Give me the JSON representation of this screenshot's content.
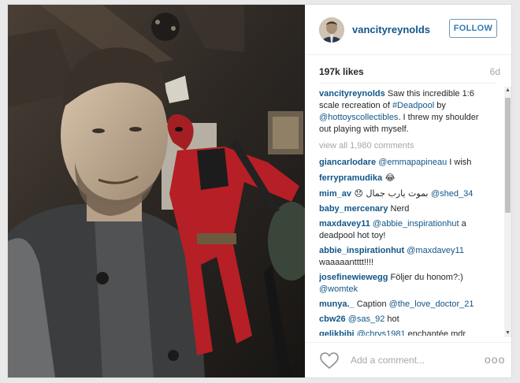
{
  "post": {
    "username": "vancityreynolds",
    "follow_label": "FOLLOW",
    "likes": "197k likes",
    "age": "6d",
    "caption": {
      "user": "vancityreynolds",
      "text_1": " Saw this incredible 1:6 scale recreation of ",
      "hashtag": "#Deadpool",
      "text_2": " by ",
      "mention": "@hottoyscollectibles",
      "text_3": ". I threw my shoulder out playing with myself."
    },
    "view_all": "view all 1,980 comments",
    "add_comment_placeholder": "Add a comment...",
    "more_label": "ooo"
  },
  "comments": [
    {
      "user": "giancarlodare",
      "mention": "@emmapapineau",
      "text": " I wish"
    },
    {
      "user": "ferrypramudika",
      "mention": "",
      "text": " 😂"
    },
    {
      "user": "mim_av",
      "mention": "@shed_34",
      "text": " 😞 بموت يارب جمال "
    },
    {
      "user": "baby_mercenary",
      "mention": "",
      "text": " Nerd"
    },
    {
      "user": "maxdavey11",
      "mention": "@abbie_inspirationhut",
      "text": " a deadpool hot toy!"
    },
    {
      "user": "abbie_inspirationhut",
      "mention": "@maxdavey11",
      "text": " waaaaantttt!!!!"
    },
    {
      "user": "josefinewiewegg",
      "mention": "",
      "text": " Följer du honom?:) ",
      "mention_after": "@womtek"
    },
    {
      "user": "munya._",
      "mention": "@the_love_doctor_21",
      "text": " Caption "
    },
    {
      "user": "cbw26",
      "mention": "@sas_92",
      "text": " hot"
    },
    {
      "user": "gelikbibi",
      "mention": "@chrys1981",
      "text": " enchantée mdr"
    }
  ],
  "icons": {
    "heart": "heart-icon",
    "scroll_up": "scroll-up-icon",
    "scroll_down": "scroll-down-icon"
  }
}
